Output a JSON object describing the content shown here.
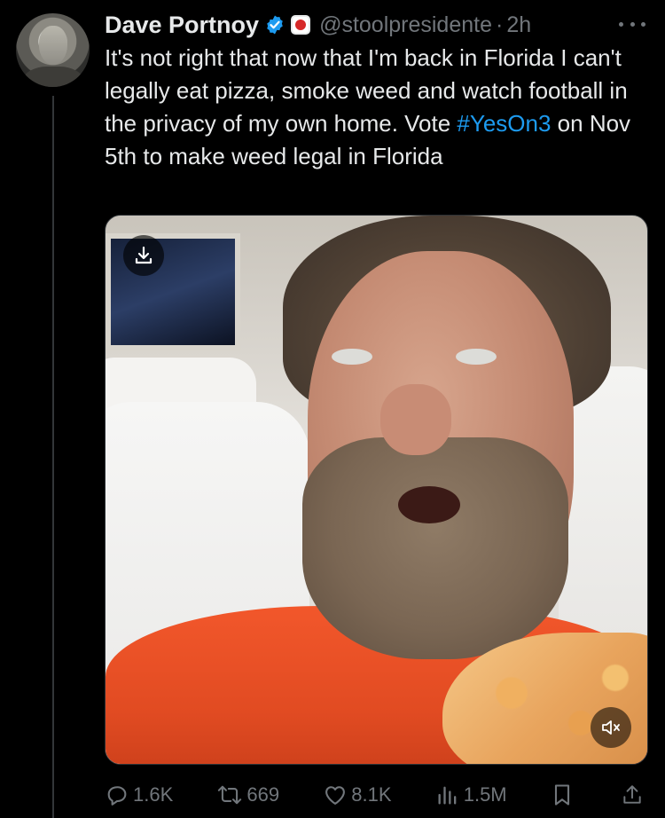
{
  "tweet": {
    "author_name": "Dave Portnoy",
    "handle": "@stoolpresidente",
    "separator": "·",
    "time": "2h",
    "text_before_hashtag": "It's not right that now that I'm back in Florida I can't legally eat pizza, smoke weed and watch football in the privacy of my own home.  Vote ",
    "hashtag": "#YesOn3",
    "text_after_hashtag": " on Nov 5th to make weed legal in Florida"
  },
  "stats": {
    "replies": "1.6K",
    "reposts": "669",
    "likes": "8.1K",
    "views": "1.5M"
  },
  "colors": {
    "background": "#000000",
    "text": "#e7e9ea",
    "muted": "#71767b",
    "link": "#1d9bf0",
    "verified": "#1d9bf0",
    "thread_line": "#333639"
  },
  "icons": [
    "verified-badge-icon",
    "org-badge-icon",
    "more-icon",
    "download-icon",
    "mute-icon",
    "reply-icon",
    "repost-icon",
    "like-icon",
    "views-icon",
    "bookmark-icon",
    "share-icon"
  ]
}
